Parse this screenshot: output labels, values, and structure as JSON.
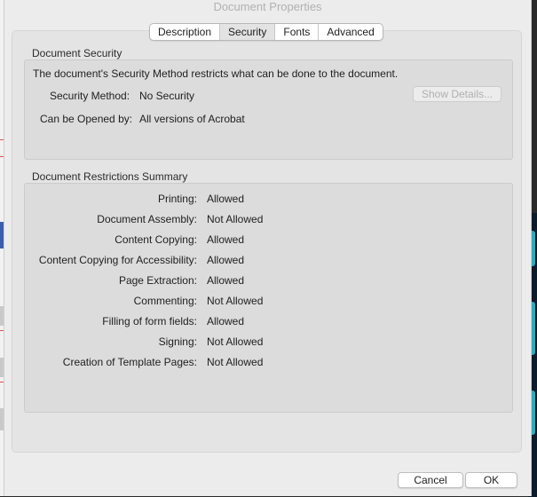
{
  "window": {
    "title": "Document Properties"
  },
  "tabs": [
    {
      "label": "Description",
      "selected": false
    },
    {
      "label": "Security",
      "selected": true
    },
    {
      "label": "Fonts",
      "selected": false
    },
    {
      "label": "Advanced",
      "selected": false
    }
  ],
  "security": {
    "section_title": "Document Security",
    "description": "The document's Security Method restricts what can be done to the document.",
    "method_label": "Security Method:",
    "method_value": "No Security",
    "show_details_label": "Show Details...",
    "opened_by_label": "Can be Opened by:",
    "opened_by_value": "All versions of Acrobat"
  },
  "restrictions": {
    "section_title": "Document Restrictions Summary",
    "rows": [
      {
        "label": "Printing:",
        "value": "Allowed"
      },
      {
        "label": "Document Assembly:",
        "value": "Not Allowed"
      },
      {
        "label": "Content Copying:",
        "value": "Allowed"
      },
      {
        "label": "Content Copying for Accessibility:",
        "value": "Allowed"
      },
      {
        "label": "Page Extraction:",
        "value": "Allowed"
      },
      {
        "label": "Commenting:",
        "value": "Not Allowed"
      },
      {
        "label": "Filling of form fields:",
        "value": "Allowed"
      },
      {
        "label": "Signing:",
        "value": "Not Allowed"
      },
      {
        "label": "Creation of Template Pages:",
        "value": "Not Allowed"
      }
    ]
  },
  "footer": {
    "cancel_label": "Cancel",
    "ok_label": "OK"
  }
}
